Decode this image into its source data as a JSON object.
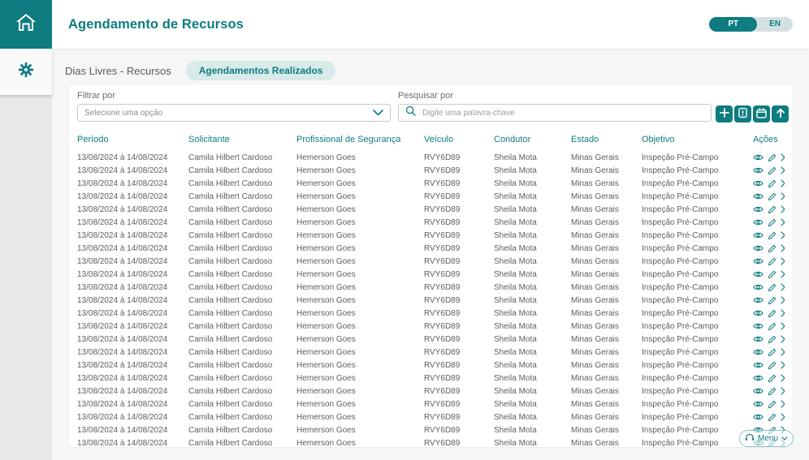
{
  "header": {
    "title": "Agendamento de Recursos",
    "language_toggle": {
      "selected": "PT",
      "options": [
        "PT",
        "EN"
      ]
    }
  },
  "sidebar": {
    "items": [
      {
        "icon": "home"
      },
      {
        "icon": "gear"
      }
    ]
  },
  "tabs": [
    {
      "label": "Dias Livres - Recursos",
      "active": false
    },
    {
      "label": "Agendamentos Realizados",
      "active": true
    }
  ],
  "filter": {
    "label": "Filtrar por",
    "value": "Selecione uma opção"
  },
  "search": {
    "label": "Pesquisar por",
    "placeholder": "Digite uma palavra-chave"
  },
  "toolbar": {
    "buttons": [
      {
        "icon": "plus"
      },
      {
        "icon": "document"
      },
      {
        "icon": "calendar"
      },
      {
        "icon": "arrow-up"
      }
    ]
  },
  "table": {
    "columns": [
      "Período",
      "Solicitante",
      "Profissional de Segurança",
      "Veículo",
      "Condutor",
      "Estado",
      "Objetivo",
      "Ações"
    ],
    "row_count": 23,
    "row_values": {
      "periodo": "13/08/2024 à 14/08/2024",
      "solicitante": "Camila Hilbert Cardoso",
      "profissional": "Hemerson Goes",
      "veiculo": "RVY6D89",
      "condutor": "Sheila Mota",
      "estado": "Minas Gerais",
      "objetivo": "Inspeção Pré-Campo"
    },
    "row_actions": [
      "view",
      "edit",
      "delete"
    ]
  },
  "floating_menu": {
    "label": "Menu"
  },
  "colors": {
    "accent": "#0e7c80",
    "accent_light": "#d8ebe9",
    "toggle_bg": "#d3e1e1",
    "page_bg": "#f6f6f6",
    "card_bg": "#ffffff"
  }
}
